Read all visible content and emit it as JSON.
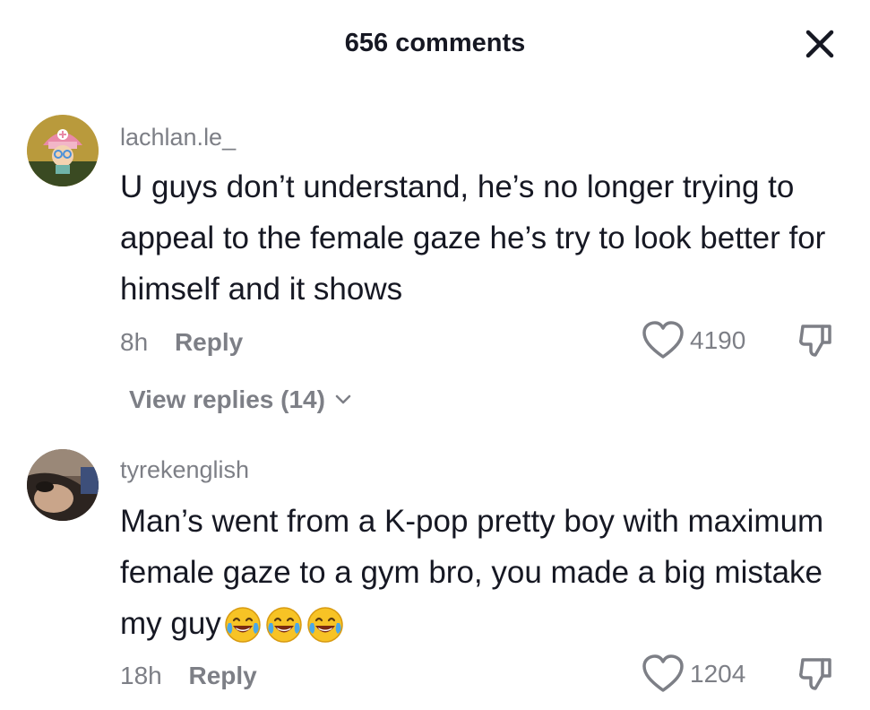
{
  "header": {
    "title": "656 comments"
  },
  "comments": [
    {
      "username": "lachlan.le_",
      "text": "U guys don’t understand, he’s no longer trying to appeal to the female gaze he’s try to look better for himself and it shows",
      "time": "8h",
      "reply_label": "Reply",
      "likes": "4190",
      "view_replies_label": "View replies (14)"
    },
    {
      "username": "tyrekenglish",
      "text": "Man’s went from a K-pop pretty boy with maximum female gaze to a gym bro, you made a big mistake my guy",
      "emoji": "😂😂😂",
      "time": "18h",
      "reply_label": "Reply",
      "likes": "1204"
    }
  ],
  "icons": {
    "close": "close-icon",
    "like": "heart-outline-icon",
    "dislike": "thumbs-down-icon",
    "expand": "chevron-down-icon",
    "emoji": "tears-of-joy-emoji-icon"
  },
  "colors": {
    "text": "#161823",
    "secondary": "#7d7f86",
    "background": "#ffffff"
  }
}
